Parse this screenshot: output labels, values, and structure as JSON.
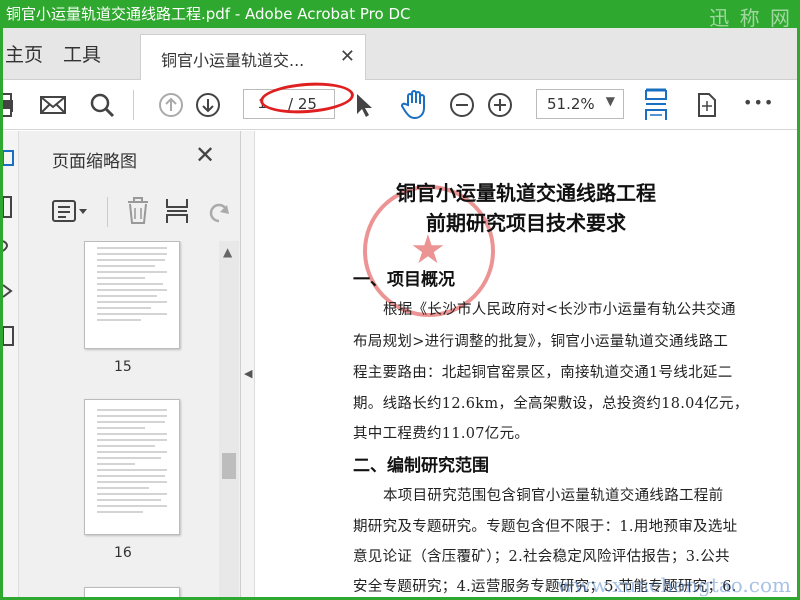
{
  "window": {
    "title": "铜官小运量轨道交通线路工程.pdf - Adobe Acrobat Pro DC",
    "watermark": "迅 称 网"
  },
  "tabs": {
    "home": "主页",
    "tools": "工具",
    "document": "铜官小运量轨道交...",
    "close_glyph": "✕"
  },
  "toolbar": {
    "page_current": "1",
    "page_total": "/ 25",
    "zoom": "51.2%",
    "zoom_caret": "▼",
    "more": "•••"
  },
  "annotation": {
    "color": "#e02020"
  },
  "panel": {
    "title": "页面缩略图",
    "close_glyph": "✕",
    "thumbnails": [
      {
        "number": "15"
      },
      {
        "number": "16"
      }
    ]
  },
  "document": {
    "title_line1": "铜官小运量轨道交通线路工程",
    "title_line2": "前期研究项目技术要求",
    "section1": "一、项目概况",
    "para1": [
      "根据《长沙市人民政府对<长沙市小运量有轨公共交通",
      "布局规划>进行调整的批复》，铜官小运量轨道交通线路工",
      "程主要路由：北起铜官窑景区，南接轨道交通1号线北延二",
      "期。线路长约12.6km，全高架敷设，总投资约18.04亿元，",
      "其中工程费约11.07亿元。"
    ],
    "section2": "二、编制研究范围",
    "para2": [
      "本项目研究范围包含铜官小运量轨道交通线路工程前",
      "期研究及专题研究。专题包含但不限于：1.用地预审及选址",
      "意见论证（含压覆矿）；2.社会稳定风险评估报告；3.公共",
      "安全专题研究；4.运营服务专题研究；5.节能专题研究；6."
    ],
    "watermark": "www.xunchengtao.com"
  }
}
